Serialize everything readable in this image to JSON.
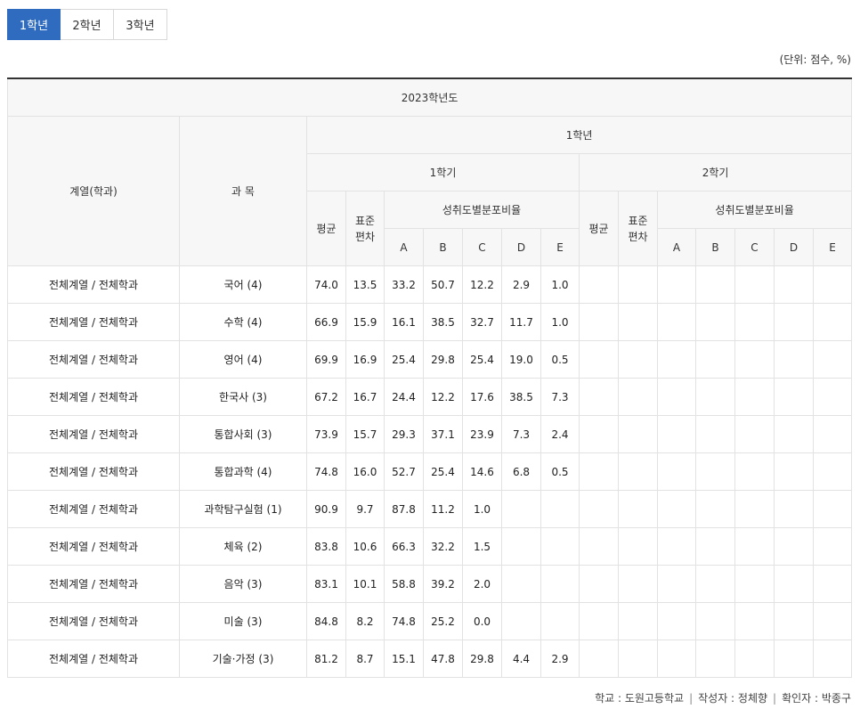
{
  "tabs": [
    {
      "label": "1학년",
      "active": true
    },
    {
      "label": "2학년",
      "active": false
    },
    {
      "label": "3학년",
      "active": false
    }
  ],
  "unit_note": "(단위: 점수, %)",
  "table": {
    "year": "2023학년도",
    "col_dept": "계열(학과)",
    "col_subject": "과 목",
    "grade": "1학년",
    "sem1": "1학기",
    "sem2": "2학기",
    "avg": "평균",
    "std_line1": "표준",
    "std_line2": "편차",
    "dist": "성취도별분포비율",
    "grades": [
      "A",
      "B",
      "C",
      "D",
      "E"
    ],
    "rows": [
      {
        "dept": "전체계열 / 전체학과",
        "subject": "국어 (4)",
        "avg": "74.0",
        "std": "13.5",
        "a": "33.2",
        "b": "50.7",
        "c": "12.2",
        "d": "2.9",
        "e": "1.0"
      },
      {
        "dept": "전체계열 / 전체학과",
        "subject": "수학 (4)",
        "avg": "66.9",
        "std": "15.9",
        "a": "16.1",
        "b": "38.5",
        "c": "32.7",
        "d": "11.7",
        "e": "1.0"
      },
      {
        "dept": "전체계열 / 전체학과",
        "subject": "영어 (4)",
        "avg": "69.9",
        "std": "16.9",
        "a": "25.4",
        "b": "29.8",
        "c": "25.4",
        "d": "19.0",
        "e": "0.5"
      },
      {
        "dept": "전체계열 / 전체학과",
        "subject": "한국사 (3)",
        "avg": "67.2",
        "std": "16.7",
        "a": "24.4",
        "b": "12.2",
        "c": "17.6",
        "d": "38.5",
        "e": "7.3"
      },
      {
        "dept": "전체계열 / 전체학과",
        "subject": "통합사회 (3)",
        "avg": "73.9",
        "std": "15.7",
        "a": "29.3",
        "b": "37.1",
        "c": "23.9",
        "d": "7.3",
        "e": "2.4"
      },
      {
        "dept": "전체계열 / 전체학과",
        "subject": "통합과학 (4)",
        "avg": "74.8",
        "std": "16.0",
        "a": "52.7",
        "b": "25.4",
        "c": "14.6",
        "d": "6.8",
        "e": "0.5"
      },
      {
        "dept": "전체계열 / 전체학과",
        "subject": "과학탐구실험 (1)",
        "avg": "90.9",
        "std": "9.7",
        "a": "87.8",
        "b": "11.2",
        "c": "1.0",
        "d": "",
        "e": ""
      },
      {
        "dept": "전체계열 / 전체학과",
        "subject": "체육 (2)",
        "avg": "83.8",
        "std": "10.6",
        "a": "66.3",
        "b": "32.2",
        "c": "1.5",
        "d": "",
        "e": ""
      },
      {
        "dept": "전체계열 / 전체학과",
        "subject": "음악 (3)",
        "avg": "83.1",
        "std": "10.1",
        "a": "58.8",
        "b": "39.2",
        "c": "2.0",
        "d": "",
        "e": ""
      },
      {
        "dept": "전체계열 / 전체학과",
        "subject": "미술 (3)",
        "avg": "84.8",
        "std": "8.2",
        "a": "74.8",
        "b": "25.2",
        "c": "0.0",
        "d": "",
        "e": ""
      },
      {
        "dept": "전체계열 / 전체학과",
        "subject": "기술·가정 (3)",
        "avg": "81.2",
        "std": "8.7",
        "a": "15.1",
        "b": "47.8",
        "c": "29.8",
        "d": "4.4",
        "e": "2.9"
      }
    ]
  },
  "footer": {
    "school": "학교 : 도원고등학교",
    "author": "작성자 : 정체향",
    "checker": "확인자 : 박종구",
    "separator": "|"
  },
  "colors": {
    "active_tab": "#2f6bbf",
    "header_bg": "#f7f7f7",
    "border": "#e2e2e2"
  }
}
